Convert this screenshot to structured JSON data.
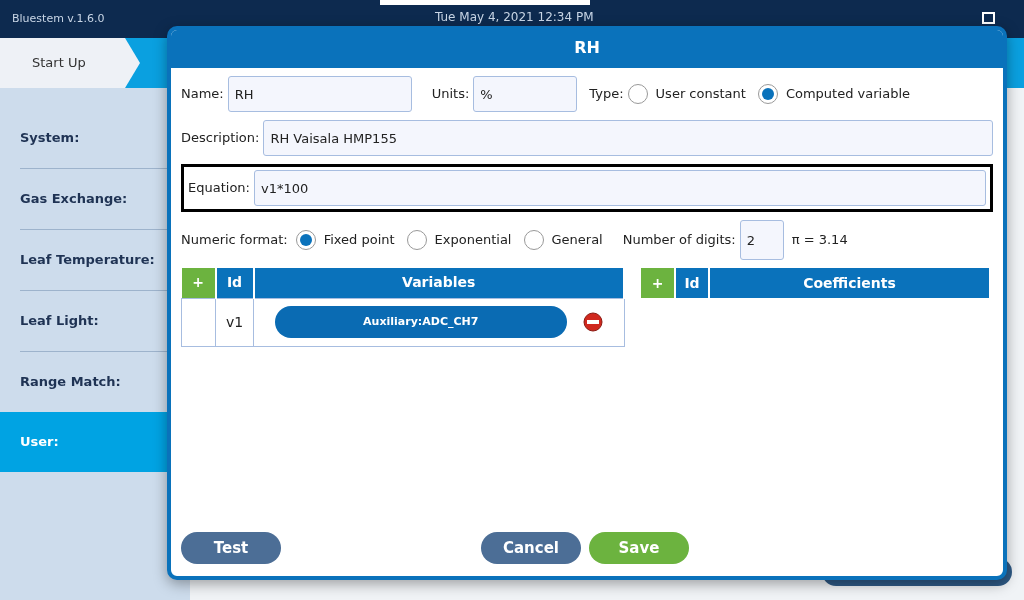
{
  "app": {
    "version": "Bluestem v.1.6.0",
    "datetime": "Tue May 4, 2021 12:34 PM"
  },
  "breadcrumb": [
    {
      "label": "Start Up",
      "selected": false
    }
  ],
  "sidebar": {
    "items": [
      {
        "label": "System:",
        "selected": false
      },
      {
        "label": "Gas Exchange:",
        "selected": false
      },
      {
        "label": "Leaf Temperature:",
        "selected": false
      },
      {
        "label": "Leaf Light:",
        "selected": false
      },
      {
        "label": "Range Match:",
        "selected": false
      },
      {
        "label": "User:",
        "selected": true
      }
    ]
  },
  "dialog": {
    "title": "RH",
    "name": {
      "label": "Name:",
      "value": "RH"
    },
    "units": {
      "label": "Units:",
      "value": "%"
    },
    "type": {
      "label": "Type:",
      "options": [
        {
          "label": "User constant",
          "selected": false
        },
        {
          "label": "Computed variable",
          "selected": true
        }
      ]
    },
    "description": {
      "label": "Description:",
      "value": "RH Vaisala HMP155"
    },
    "equation": {
      "label": "Equation:",
      "value": "v1*100"
    },
    "numeric_format": {
      "label": "Numeric format:",
      "options": [
        {
          "label": "Fixed point",
          "selected": true
        },
        {
          "label": "Exponential",
          "selected": false
        },
        {
          "label": "General",
          "selected": false
        }
      ]
    },
    "digits": {
      "label": "Number of digits:",
      "value": "2",
      "preview": "π = 3.14"
    },
    "variables": {
      "add": "+",
      "columns": [
        "Id",
        "Variables"
      ],
      "rows": [
        {
          "id": "v1",
          "source": "Auxiliary:ADC_CH7"
        }
      ]
    },
    "coefficients": {
      "add": "+",
      "columns": [
        "Id",
        "Coefficients"
      ]
    },
    "buttons": [
      {
        "label": "Test",
        "kind": "secondary"
      },
      {
        "label": "Cancel",
        "kind": "secondary"
      },
      {
        "label": "Save",
        "kind": "primary"
      }
    ]
  }
}
